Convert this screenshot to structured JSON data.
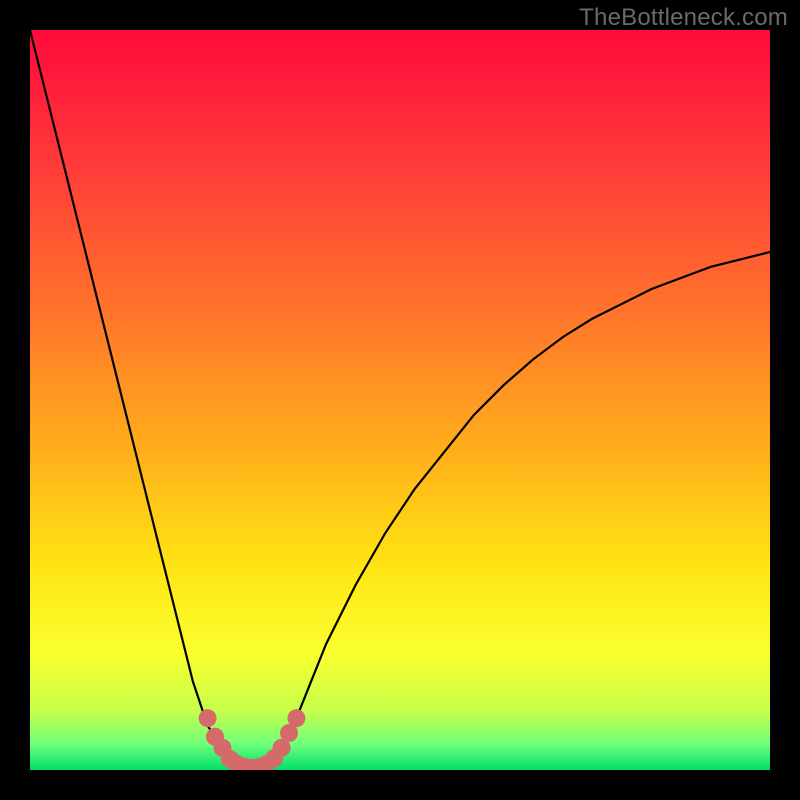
{
  "watermark": "TheBottleneck.com",
  "colors": {
    "frame": "#000000",
    "curve": "#000000",
    "marker_fill": "#d46a6a",
    "gradient_stops": [
      {
        "offset": 0.0,
        "color": "#ff0a3a"
      },
      {
        "offset": 0.18,
        "color": "#ff3a3a"
      },
      {
        "offset": 0.4,
        "color": "#ff7a2a"
      },
      {
        "offset": 0.58,
        "color": "#ffb21a"
      },
      {
        "offset": 0.72,
        "color": "#ffe313"
      },
      {
        "offset": 0.84,
        "color": "#fbff2e"
      },
      {
        "offset": 0.92,
        "color": "#c6ff4a"
      },
      {
        "offset": 0.965,
        "color": "#6fff7a"
      },
      {
        "offset": 1.0,
        "color": "#00e06a"
      }
    ]
  },
  "chart_data": {
    "type": "line",
    "title": "",
    "xlabel": "",
    "ylabel": "",
    "xlim": [
      0,
      100
    ],
    "ylim": [
      0,
      100
    ],
    "x": [
      0,
      2,
      4,
      6,
      8,
      10,
      12,
      14,
      16,
      18,
      20,
      22,
      24,
      26,
      27,
      28,
      29,
      30,
      31,
      32,
      33,
      34,
      36,
      38,
      40,
      44,
      48,
      52,
      56,
      60,
      64,
      68,
      72,
      76,
      80,
      84,
      88,
      92,
      96,
      100
    ],
    "series": [
      {
        "name": "bottleneck",
        "values": [
          100,
          92,
          84,
          76,
          68,
          60,
          52,
          44,
          36,
          28,
          20,
          12,
          6,
          3,
          1.5,
          0.8,
          0.4,
          0.3,
          0.4,
          0.8,
          1.6,
          3,
          7,
          12,
          17,
          25,
          32,
          38,
          43,
          48,
          52,
          55.5,
          58.5,
          61,
          63,
          65,
          66.5,
          68,
          69,
          70
        ]
      }
    ],
    "markers": {
      "name": "bottom-region",
      "x": [
        24,
        25,
        26,
        27,
        28,
        29,
        30,
        31,
        32,
        33,
        34,
        35,
        36
      ],
      "y": [
        7,
        4.5,
        3,
        1.5,
        0.8,
        0.4,
        0.3,
        0.4,
        0.8,
        1.6,
        3,
        5,
        7
      ]
    }
  }
}
